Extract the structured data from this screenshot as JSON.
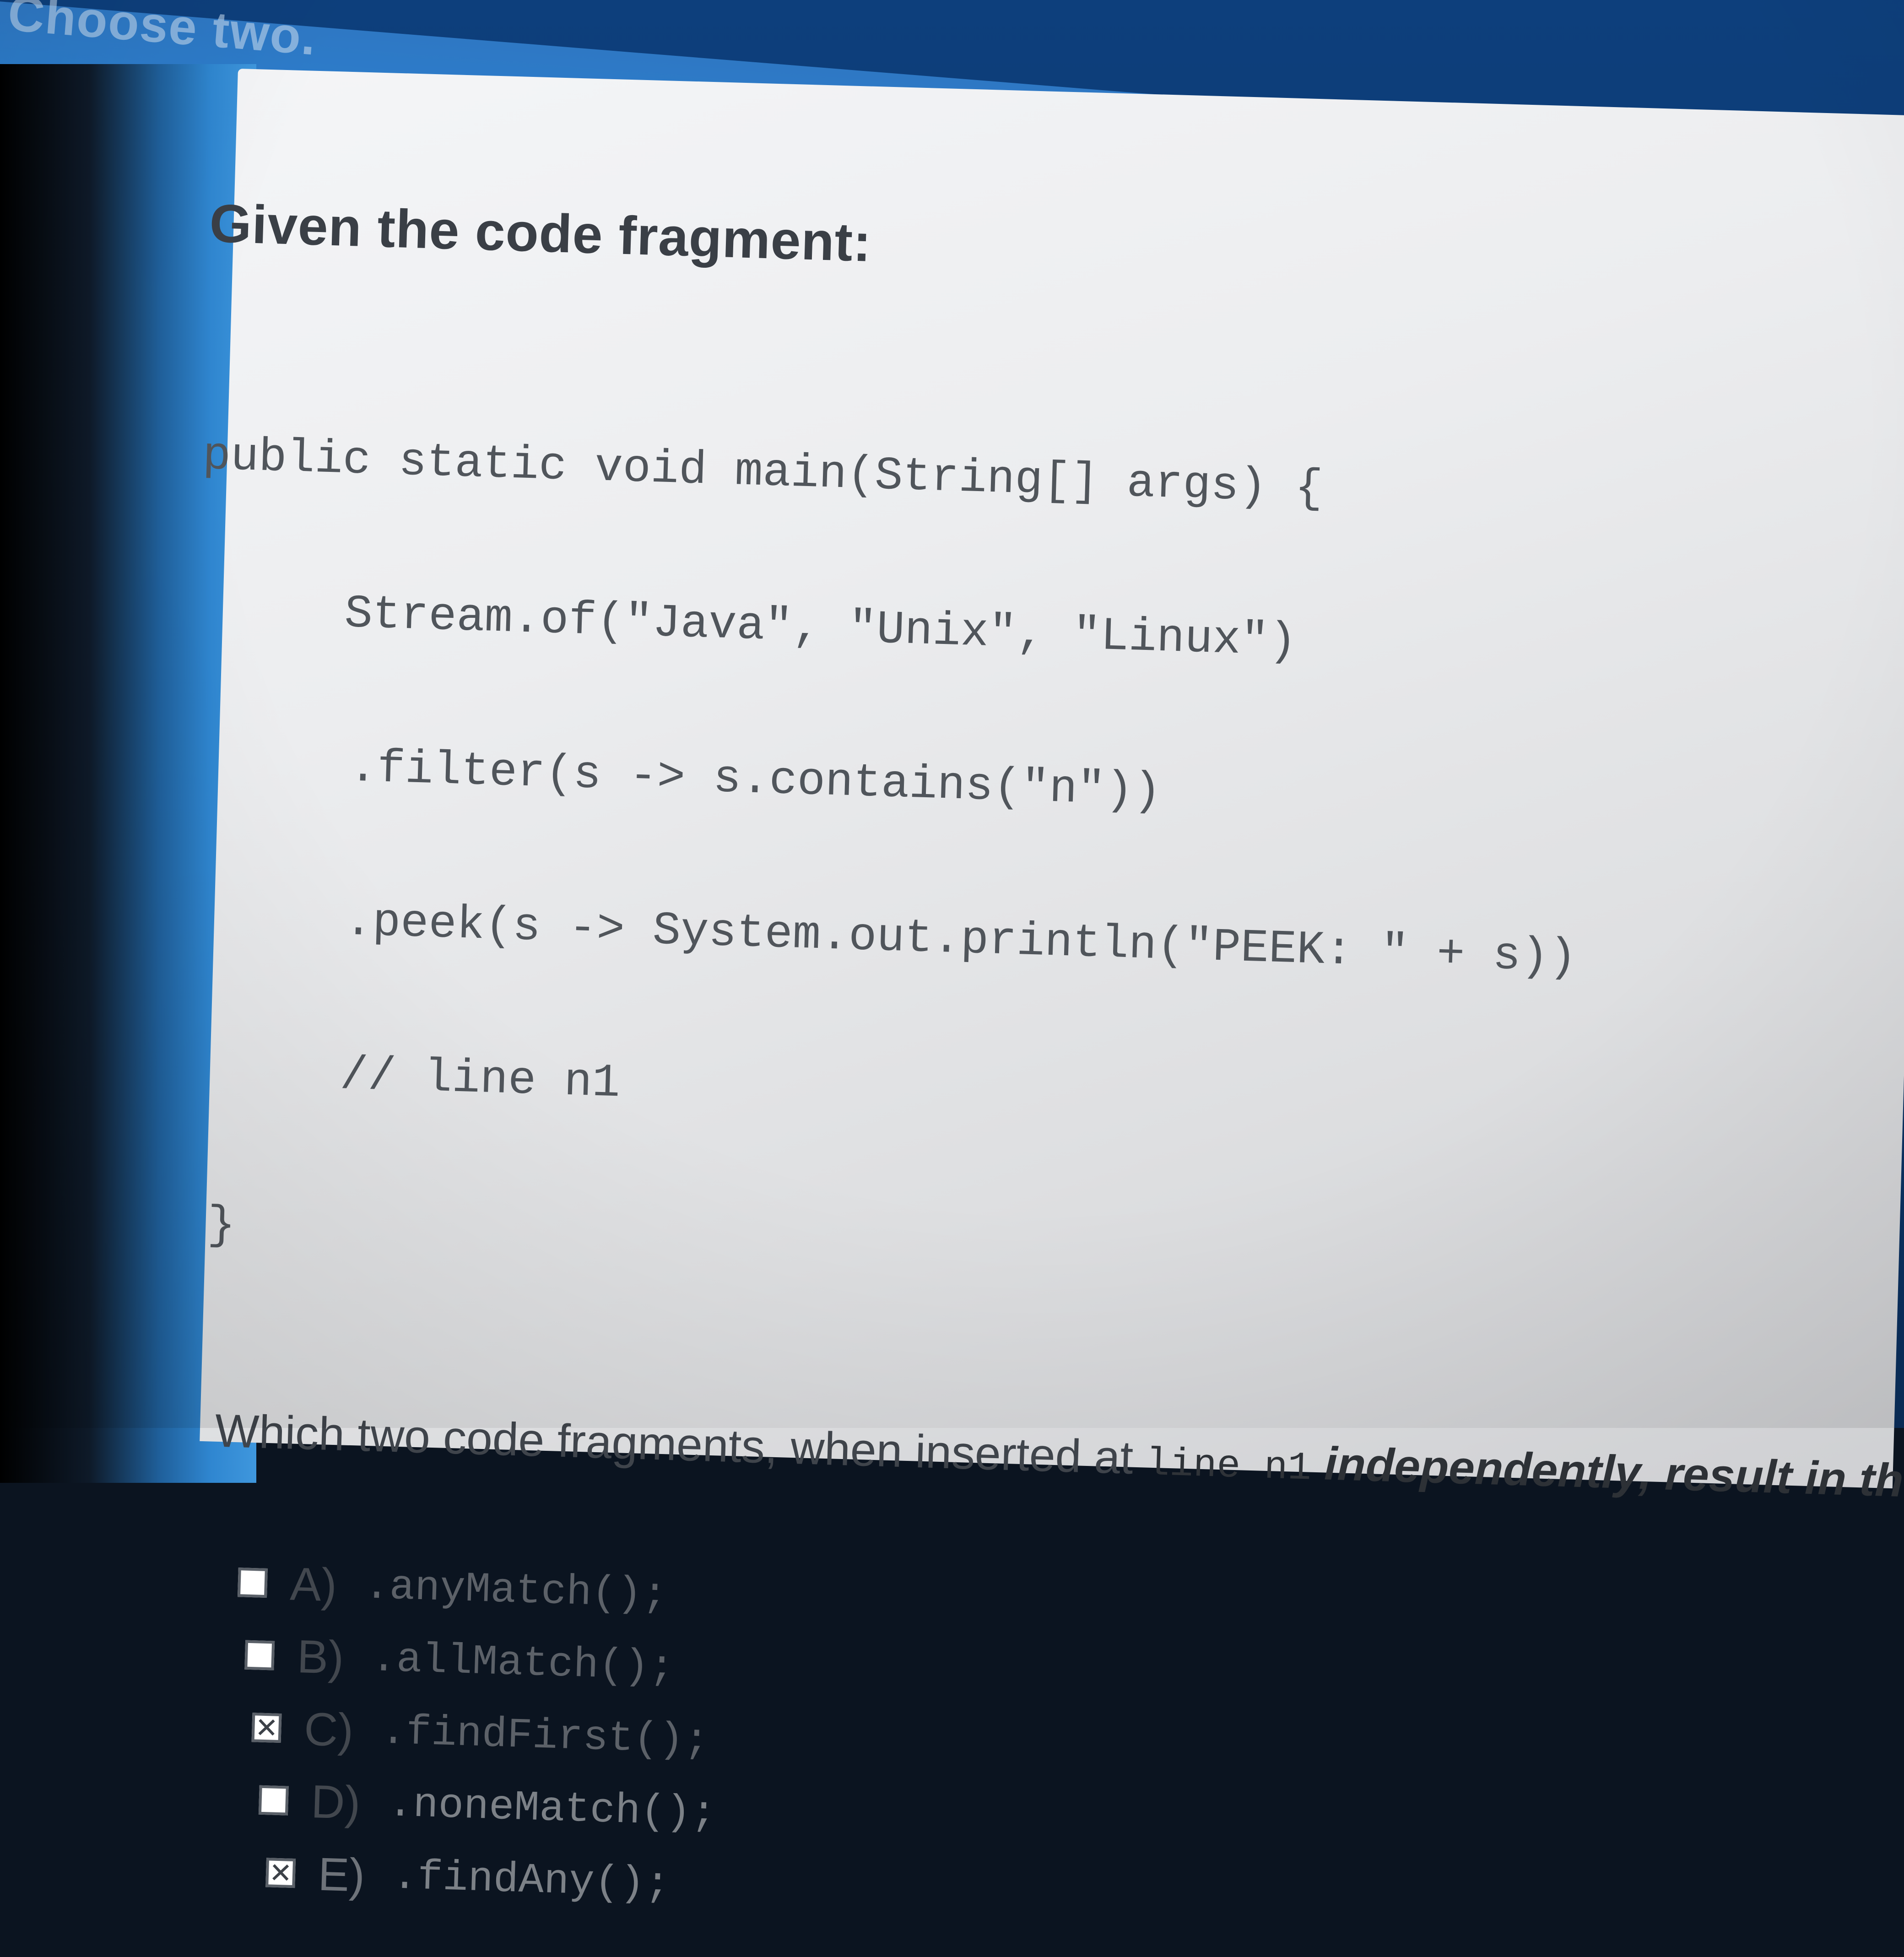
{
  "header": {
    "title": "Choose two."
  },
  "question": {
    "heading": "Given the code fragment:",
    "code_lines": [
      "public static void main(String[] args) {",
      "Stream.of(\"Java\", \"Unix\", \"Linux\")",
      ".filter(s -> s.contains(\"n\"))",
      ".peek(s -> System.out.println(\"PEEK: \" + s))",
      "// line n1",
      "}"
    ],
    "prompt_start": "Which two code fragments, when inserted at ",
    "prompt_code": "line n1",
    "prompt_end": " independently, result in th"
  },
  "options": [
    {
      "letter": "A)",
      "code": ".anyMatch();",
      "checked": false
    },
    {
      "letter": "B)",
      "code": ".allMatch();",
      "checked": false
    },
    {
      "letter": "C)",
      "code": ".findFirst();",
      "checked": true
    },
    {
      "letter": "D)",
      "code": ".noneMatch();",
      "checked": false
    },
    {
      "letter": "E)",
      "code": ".findAny();",
      "checked": true
    }
  ],
  "colors": {
    "header_blue": "#2b7fcf",
    "panel_bg": "#ecedef",
    "text": "#3a3f46"
  }
}
